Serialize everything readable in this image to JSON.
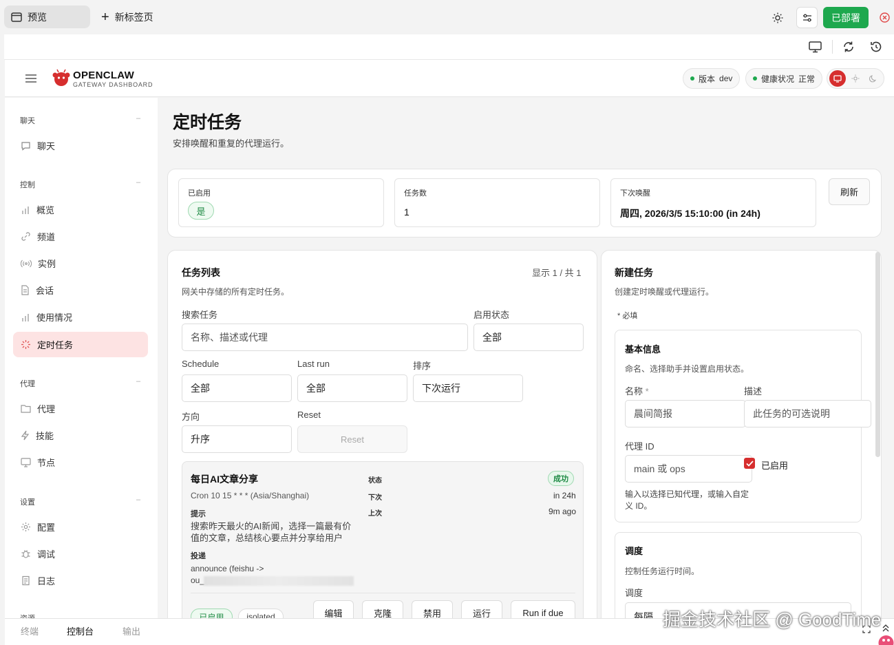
{
  "browser": {
    "tab_preview": "预览",
    "tab_new": "新标签页",
    "deploy_label": "已部署"
  },
  "header": {
    "brand_title": "OPENCLAW",
    "brand_subtitle": "GATEWAY DASHBOARD",
    "version_label": "版本",
    "version_value": "dev",
    "health_label": "健康状况",
    "health_value": "正常"
  },
  "sidebar": {
    "sections": [
      {
        "label": "聊天",
        "items": [
          "聊天"
        ]
      },
      {
        "label": "控制",
        "items": [
          "概览",
          "频道",
          "实例",
          "会话",
          "使用情况",
          "定时任务"
        ]
      },
      {
        "label": "代理",
        "items": [
          "代理",
          "技能",
          "节点"
        ]
      },
      {
        "label": "设置",
        "items": [
          "配置",
          "调试",
          "日志"
        ]
      },
      {
        "label": "资源",
        "items": []
      }
    ],
    "active_item": "定时任务"
  },
  "page": {
    "title": "定时任务",
    "subtitle": "安排唤醒和重复的代理运行。"
  },
  "stats": {
    "enabled_label": "已启用",
    "enabled_value": "是",
    "jobs_label": "任务数",
    "jobs_value": "1",
    "next_wake_label": "下次唤醒",
    "next_wake_value": "周四, 2026/3/5 15:10:00 (in 24h)",
    "refresh_label": "刷新"
  },
  "job_list": {
    "title": "任务列表",
    "subtitle": "网关中存储的所有定时任务。",
    "count_text": "显示 1 / 共 1",
    "search_label": "搜索任务",
    "search_placeholder": "名称、描述或代理",
    "enabled_filter_label": "启用状态",
    "enabled_filter_value": "全部",
    "schedule_label": "Schedule",
    "schedule_value": "全部",
    "lastrun_label": "Last run",
    "lastrun_value": "全部",
    "sort_label": "排序",
    "sort_value": "下次运行",
    "direction_label": "方向",
    "direction_value": "升序",
    "reset_label": "Reset",
    "reset_button": "Reset"
  },
  "job": {
    "name": "每日AI文章分享",
    "schedule": "Cron 10 15 * * * (Asia/Shanghai)",
    "prompt_label": "提示",
    "prompt_text": "搜索昨天最火的AI新闻，选择一篇最有价值的文章，总结核心要点并分享给用户",
    "delivery_label": "投递",
    "delivery_text": "announce (feishu ->",
    "delivery_text2": "ou_",
    "status_label": "状态",
    "status_value": "成功",
    "next_label": "下次",
    "next_value": "in 24h",
    "last_label": "上次",
    "last_value": "9m ago",
    "tag_enabled": "已启用",
    "tag_isolated": "isolated",
    "actions": [
      "编辑",
      "克隆",
      "禁用",
      "运行",
      "Run if due"
    ]
  },
  "new_job": {
    "title": "新建任务",
    "subtitle": "创建定时唤醒或代理运行。",
    "required_note": "* 必填",
    "basic_title": "基本信息",
    "basic_subtitle": "命名、选择助手并设置启用状态。",
    "name_label": "名称",
    "name_required": "*",
    "name_placeholder": "晨间简报",
    "desc_label": "描述",
    "desc_placeholder": "此任务的可选说明",
    "agent_label": "代理 ID",
    "agent_placeholder": "main 或 ops",
    "enabled_checkbox": "已启用",
    "enabled_checked": true,
    "agent_help": "输入以选择已知代理，或输入自定义 ID。",
    "schedule_title": "调度",
    "schedule_subtitle": "控制任务运行时间。",
    "schedule_label": "调度",
    "schedule_value": "每隔"
  },
  "bottom": {
    "tabs": [
      "终端",
      "控制台",
      "输出"
    ],
    "active_tab": "控制台"
  },
  "watermark": "掘金技术社区 @ GoodTime"
}
